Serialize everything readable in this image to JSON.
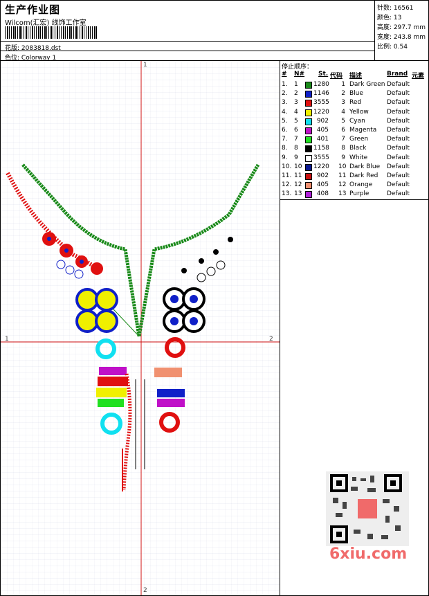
{
  "header": {
    "title": "生产作业图",
    "subtitle": "Wilcom(汇宏) 线饰工作室",
    "design_label": "花版:",
    "design_value": "2083818.dst",
    "colorway_label": "色位:",
    "colorway_value": "Colorway 1"
  },
  "stats": {
    "stitches": "针数: 16561",
    "colors": "颜色: 13",
    "height": "高度: 297.7 mm",
    "width": "宽度: 243.8 mm",
    "scale": "比例: 0.54"
  },
  "canvas": {
    "axis_top": "1",
    "axis_bottom": "2",
    "axis_left": "1",
    "axis_right": "2"
  },
  "panel": {
    "title": "停止顺序：",
    "headers": [
      "#",
      "N#",
      "St.",
      "代码",
      "描述",
      "Brand",
      "元素"
    ],
    "rows": [
      {
        "idx": "1.",
        "n": "1",
        "st": "1280",
        "code": "1",
        "desc": "Dark Green",
        "brand": "Default",
        "color": "#1a8a1a"
      },
      {
        "idx": "2.",
        "n": "2",
        "st": "1146",
        "code": "2",
        "desc": "Blue",
        "brand": "Default",
        "color": "#1020c8"
      },
      {
        "idx": "3.",
        "n": "3",
        "st": "3555",
        "code": "3",
        "desc": "Red",
        "brand": "Default",
        "color": "#e01010"
      },
      {
        "idx": "4.",
        "n": "4",
        "st": "1220",
        "code": "4",
        "desc": "Yellow",
        "brand": "Default",
        "color": "#f0f000"
      },
      {
        "idx": "5.",
        "n": "5",
        "st": "902",
        "code": "5",
        "desc": "Cyan",
        "brand": "Default",
        "color": "#10e0f0"
      },
      {
        "idx": "6.",
        "n": "6",
        "st": "405",
        "code": "6",
        "desc": "Magenta",
        "brand": "Default",
        "color": "#c010c8"
      },
      {
        "idx": "7.",
        "n": "7",
        "st": "401",
        "code": "7",
        "desc": "Green",
        "brand": "Default",
        "color": "#20e020"
      },
      {
        "idx": "8.",
        "n": "8",
        "st": "1158",
        "code": "8",
        "desc": "Black",
        "brand": "Default",
        "color": "#000000"
      },
      {
        "idx": "9.",
        "n": "9",
        "st": "3555",
        "code": "9",
        "desc": "White",
        "brand": "Default",
        "color": "#ffffff"
      },
      {
        "idx": "10.",
        "n": "10",
        "st": "1220",
        "code": "10",
        "desc": "Dark Blue",
        "brand": "Default",
        "color": "#0a1890"
      },
      {
        "idx": "11.",
        "n": "11",
        "st": "902",
        "code": "11",
        "desc": "Dark Red",
        "brand": "Default",
        "color": "#c81010"
      },
      {
        "idx": "12.",
        "n": "12",
        "st": "405",
        "code": "12",
        "desc": "Orange",
        "brand": "Default",
        "color": "#f09070"
      },
      {
        "idx": "13.",
        "n": "13",
        "st": "408",
        "code": "13",
        "desc": "Purple",
        "brand": "Default",
        "color": "#b020d8"
      }
    ]
  },
  "watermark": "6xiu.com"
}
